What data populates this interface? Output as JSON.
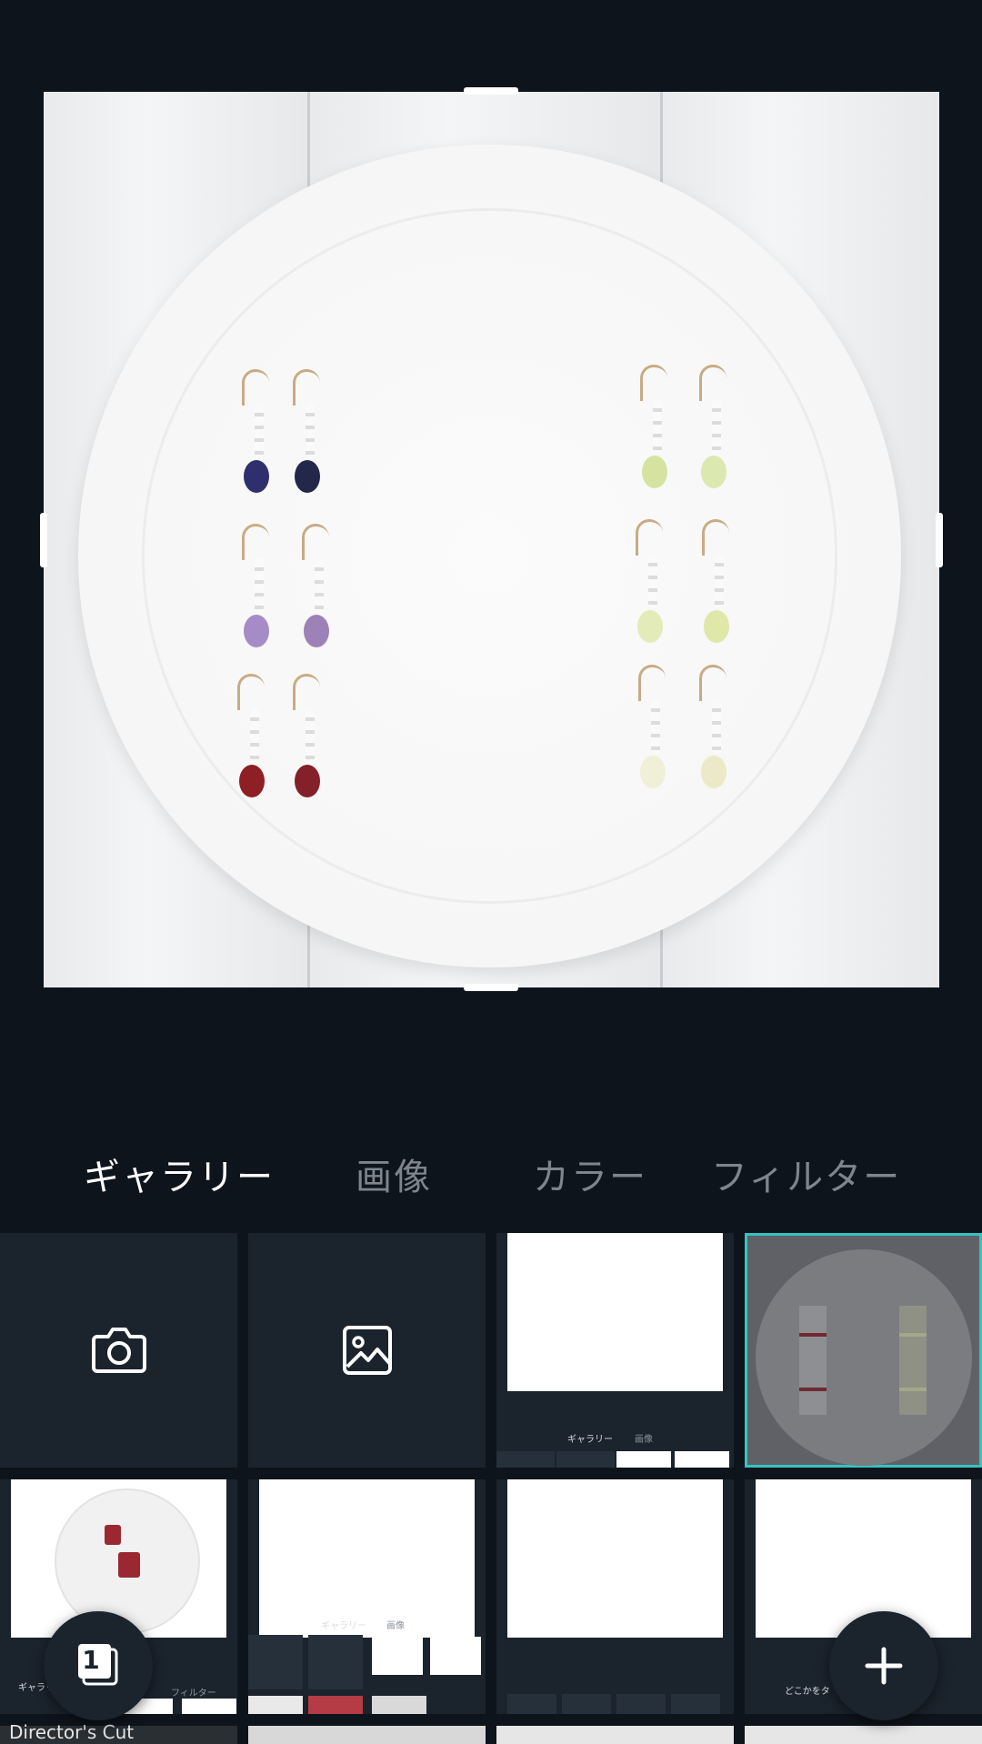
{
  "tabs": [
    {
      "label": "ギャラリー",
      "active": true
    },
    {
      "label": "画像",
      "active": false
    },
    {
      "label": "カラー",
      "active": false
    },
    {
      "label": "フィルター",
      "active": false
    }
  ],
  "grid": {
    "camera_tile": {
      "icon": "camera-icon"
    },
    "image_tile": {
      "icon": "image-icon"
    },
    "mini_tabs": {
      "gallery": "ギャラリー",
      "image": "画像",
      "filter": "フィルター"
    },
    "mini_caption": "どこかをタ",
    "bottom_label": "Director's Cut"
  },
  "page_counter": {
    "value": "1"
  },
  "add_button": {
    "icon": "plus-icon"
  },
  "colors": {
    "background": "#0e141b",
    "tile": "#1b232d",
    "selection": "#35c3c1",
    "tab_inactive": "#7d858f"
  }
}
